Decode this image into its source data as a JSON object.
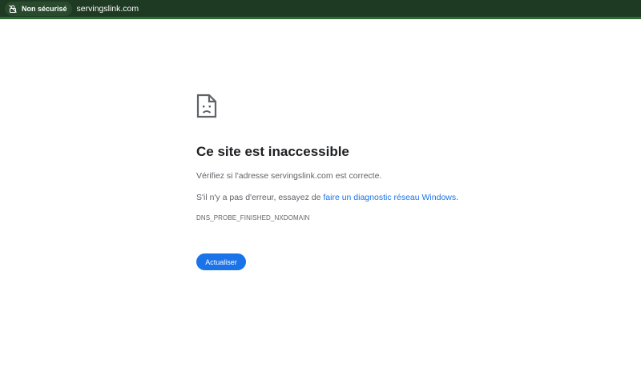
{
  "address_bar": {
    "security_label": "Non sécurisé",
    "security_icon": "not-secure-lock-icon",
    "url": "servingslink.com",
    "bg_color": "#1e3a22"
  },
  "error_page": {
    "icon": "sad-page-icon",
    "title": "Ce site est inaccessible",
    "check_text": "Vérifiez si l'adresse servingslink.com est correcte.",
    "suggestion_prefix": "S'il n'y a pas d'erreur, essayez de ",
    "suggestion_link": "faire un diagnostic réseau Windows",
    "suggestion_suffix": ".",
    "error_code": "DNS_PROBE_FINISHED_NXDOMAIN",
    "reload_label": "Actualiser",
    "accent_color": "#1a73e8"
  }
}
